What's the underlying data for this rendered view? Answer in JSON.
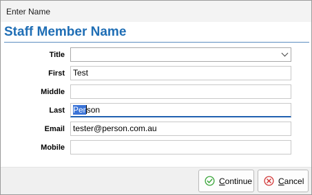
{
  "window": {
    "title": "Enter Name"
  },
  "form": {
    "heading": "Staff Member Name",
    "fields": {
      "title": {
        "label": "Title",
        "value": ""
      },
      "first": {
        "label": "First",
        "value": "Test"
      },
      "middle": {
        "label": "Middle",
        "value": ""
      },
      "last": {
        "label": "Last",
        "value_selected": "Per",
        "value_rest": "son"
      },
      "email": {
        "label": "Email",
        "value": "tester@person.com.au"
      },
      "mobile": {
        "label": "Mobile",
        "value": ""
      }
    }
  },
  "buttons": {
    "continue": {
      "accel": "C",
      "rest": "ontinue",
      "icon": "check-circle-icon",
      "color": "#3aa53a"
    },
    "cancel": {
      "accel": "C",
      "rest": "ancel",
      "icon": "cancel-circle-icon",
      "color": "#d23a3a"
    }
  }
}
